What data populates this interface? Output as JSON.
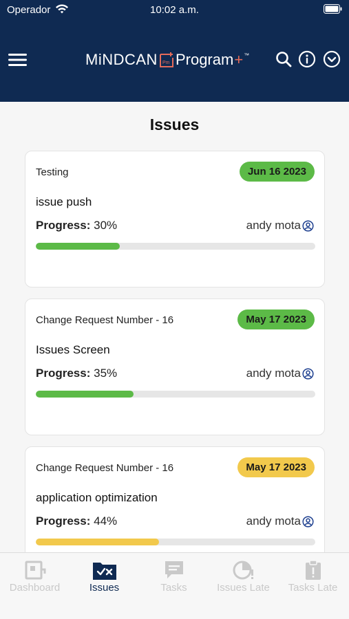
{
  "status_bar": {
    "carrier": "Operador",
    "time": "10:02 a.m."
  },
  "header": {
    "logo_main": "MiNDCAN",
    "logo_box": "Pm",
    "logo_program": "Program",
    "logo_plus": "+",
    "logo_tm": "™"
  },
  "page": {
    "title": "Issues"
  },
  "labels": {
    "progress": "Progress:"
  },
  "issues": [
    {
      "category": "Testing",
      "date": "Jun 16 2023",
      "badge_color": "#5cba47",
      "title": "issue push",
      "progress_text": "30%",
      "progress": 0.3,
      "bar_color": "#5cba47",
      "assignee": "andy mota"
    },
    {
      "category": "Change Request Number - 16",
      "date": "May 17 2023",
      "badge_color": "#5cba47",
      "title": "Issues Screen",
      "progress_text": "35%",
      "progress": 0.35,
      "bar_color": "#5cba47",
      "assignee": "andy mota"
    },
    {
      "category": "Change Request Number - 16",
      "date": "May 17 2023",
      "badge_color": "#f2c94c",
      "title": "application optimization",
      "progress_text": "44%",
      "progress": 0.44,
      "bar_color": "#f2c94c",
      "assignee": "andy mota"
    }
  ],
  "tabs": [
    {
      "label": "Dashboard",
      "icon": "dashboard-icon",
      "active": false
    },
    {
      "label": "Issues",
      "icon": "issues-icon",
      "active": true
    },
    {
      "label": "Tasks",
      "icon": "tasks-icon",
      "active": false
    },
    {
      "label": "Issues Late",
      "icon": "issues-late-icon",
      "active": false
    },
    {
      "label": "Tasks Late",
      "icon": "tasks-late-icon",
      "active": false
    }
  ],
  "colors": {
    "header_bg": "#0f2a52",
    "accent_red": "#e46b5a",
    "green": "#5cba47",
    "yellow": "#f2c94c",
    "user_icon": "#1d3f8f"
  }
}
